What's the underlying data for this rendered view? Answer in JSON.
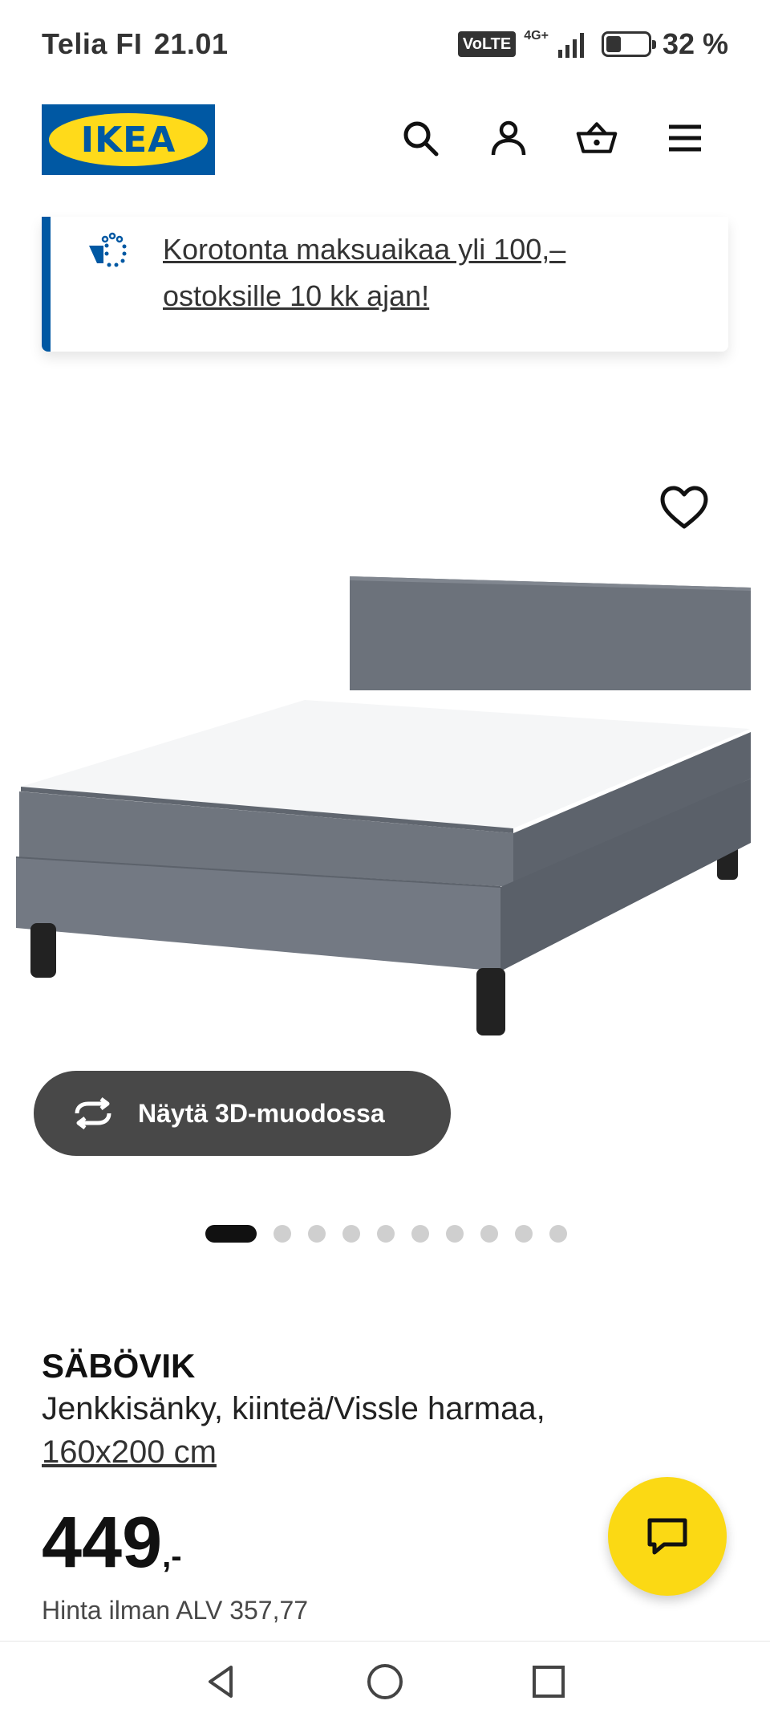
{
  "status_bar": {
    "carrier": "Telia FI",
    "time": "21.01",
    "volte": "VoLTE",
    "network": "4G+",
    "battery_text": "32 %",
    "battery_level": 0.32
  },
  "header": {
    "logo_text": "IKEA",
    "icons": [
      "search-icon",
      "account-icon",
      "basket-icon",
      "menu-icon"
    ]
  },
  "promo": {
    "text": "Korotonta maksuaikaa yli 100,– ostoksille 10 kk ajan!"
  },
  "product_gallery": {
    "view_3d_label": "Näytä 3D-muodossa",
    "image_count": 10,
    "active_index": 0
  },
  "product": {
    "name": "SÄBÖVIK",
    "description": "Jenkkisänky, kiinteä/Vissle harmaa,",
    "size": "160x200 cm",
    "price": "449",
    "price_suffix": ",-",
    "price_vat": "Hinta ilman ALV 357,77"
  },
  "colors": {
    "ikea_blue": "#0058a3",
    "ikea_yellow": "#ffda1a",
    "chat_yellow": "#fbd914",
    "button_dark": "#484848"
  }
}
